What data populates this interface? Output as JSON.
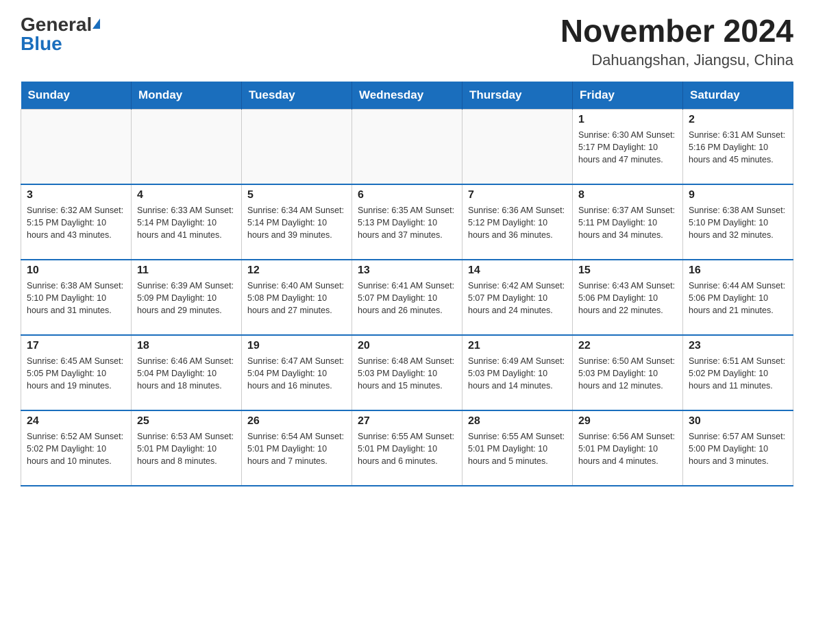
{
  "header": {
    "month_year": "November 2024",
    "location": "Dahuangshan, Jiangsu, China",
    "logo_general": "General",
    "logo_blue": "Blue"
  },
  "weekdays": [
    "Sunday",
    "Monday",
    "Tuesday",
    "Wednesday",
    "Thursday",
    "Friday",
    "Saturday"
  ],
  "weeks": [
    {
      "days": [
        {
          "num": "",
          "info": ""
        },
        {
          "num": "",
          "info": ""
        },
        {
          "num": "",
          "info": ""
        },
        {
          "num": "",
          "info": ""
        },
        {
          "num": "",
          "info": ""
        },
        {
          "num": "1",
          "info": "Sunrise: 6:30 AM\nSunset: 5:17 PM\nDaylight: 10 hours\nand 47 minutes."
        },
        {
          "num": "2",
          "info": "Sunrise: 6:31 AM\nSunset: 5:16 PM\nDaylight: 10 hours\nand 45 minutes."
        }
      ]
    },
    {
      "days": [
        {
          "num": "3",
          "info": "Sunrise: 6:32 AM\nSunset: 5:15 PM\nDaylight: 10 hours\nand 43 minutes."
        },
        {
          "num": "4",
          "info": "Sunrise: 6:33 AM\nSunset: 5:14 PM\nDaylight: 10 hours\nand 41 minutes."
        },
        {
          "num": "5",
          "info": "Sunrise: 6:34 AM\nSunset: 5:14 PM\nDaylight: 10 hours\nand 39 minutes."
        },
        {
          "num": "6",
          "info": "Sunrise: 6:35 AM\nSunset: 5:13 PM\nDaylight: 10 hours\nand 37 minutes."
        },
        {
          "num": "7",
          "info": "Sunrise: 6:36 AM\nSunset: 5:12 PM\nDaylight: 10 hours\nand 36 minutes."
        },
        {
          "num": "8",
          "info": "Sunrise: 6:37 AM\nSunset: 5:11 PM\nDaylight: 10 hours\nand 34 minutes."
        },
        {
          "num": "9",
          "info": "Sunrise: 6:38 AM\nSunset: 5:10 PM\nDaylight: 10 hours\nand 32 minutes."
        }
      ]
    },
    {
      "days": [
        {
          "num": "10",
          "info": "Sunrise: 6:38 AM\nSunset: 5:10 PM\nDaylight: 10 hours\nand 31 minutes."
        },
        {
          "num": "11",
          "info": "Sunrise: 6:39 AM\nSunset: 5:09 PM\nDaylight: 10 hours\nand 29 minutes."
        },
        {
          "num": "12",
          "info": "Sunrise: 6:40 AM\nSunset: 5:08 PM\nDaylight: 10 hours\nand 27 minutes."
        },
        {
          "num": "13",
          "info": "Sunrise: 6:41 AM\nSunset: 5:07 PM\nDaylight: 10 hours\nand 26 minutes."
        },
        {
          "num": "14",
          "info": "Sunrise: 6:42 AM\nSunset: 5:07 PM\nDaylight: 10 hours\nand 24 minutes."
        },
        {
          "num": "15",
          "info": "Sunrise: 6:43 AM\nSunset: 5:06 PM\nDaylight: 10 hours\nand 22 minutes."
        },
        {
          "num": "16",
          "info": "Sunrise: 6:44 AM\nSunset: 5:06 PM\nDaylight: 10 hours\nand 21 minutes."
        }
      ]
    },
    {
      "days": [
        {
          "num": "17",
          "info": "Sunrise: 6:45 AM\nSunset: 5:05 PM\nDaylight: 10 hours\nand 19 minutes."
        },
        {
          "num": "18",
          "info": "Sunrise: 6:46 AM\nSunset: 5:04 PM\nDaylight: 10 hours\nand 18 minutes."
        },
        {
          "num": "19",
          "info": "Sunrise: 6:47 AM\nSunset: 5:04 PM\nDaylight: 10 hours\nand 16 minutes."
        },
        {
          "num": "20",
          "info": "Sunrise: 6:48 AM\nSunset: 5:03 PM\nDaylight: 10 hours\nand 15 minutes."
        },
        {
          "num": "21",
          "info": "Sunrise: 6:49 AM\nSunset: 5:03 PM\nDaylight: 10 hours\nand 14 minutes."
        },
        {
          "num": "22",
          "info": "Sunrise: 6:50 AM\nSunset: 5:03 PM\nDaylight: 10 hours\nand 12 minutes."
        },
        {
          "num": "23",
          "info": "Sunrise: 6:51 AM\nSunset: 5:02 PM\nDaylight: 10 hours\nand 11 minutes."
        }
      ]
    },
    {
      "days": [
        {
          "num": "24",
          "info": "Sunrise: 6:52 AM\nSunset: 5:02 PM\nDaylight: 10 hours\nand 10 minutes."
        },
        {
          "num": "25",
          "info": "Sunrise: 6:53 AM\nSunset: 5:01 PM\nDaylight: 10 hours\nand 8 minutes."
        },
        {
          "num": "26",
          "info": "Sunrise: 6:54 AM\nSunset: 5:01 PM\nDaylight: 10 hours\nand 7 minutes."
        },
        {
          "num": "27",
          "info": "Sunrise: 6:55 AM\nSunset: 5:01 PM\nDaylight: 10 hours\nand 6 minutes."
        },
        {
          "num": "28",
          "info": "Sunrise: 6:55 AM\nSunset: 5:01 PM\nDaylight: 10 hours\nand 5 minutes."
        },
        {
          "num": "29",
          "info": "Sunrise: 6:56 AM\nSunset: 5:01 PM\nDaylight: 10 hours\nand 4 minutes."
        },
        {
          "num": "30",
          "info": "Sunrise: 6:57 AM\nSunset: 5:00 PM\nDaylight: 10 hours\nand 3 minutes."
        }
      ]
    }
  ]
}
